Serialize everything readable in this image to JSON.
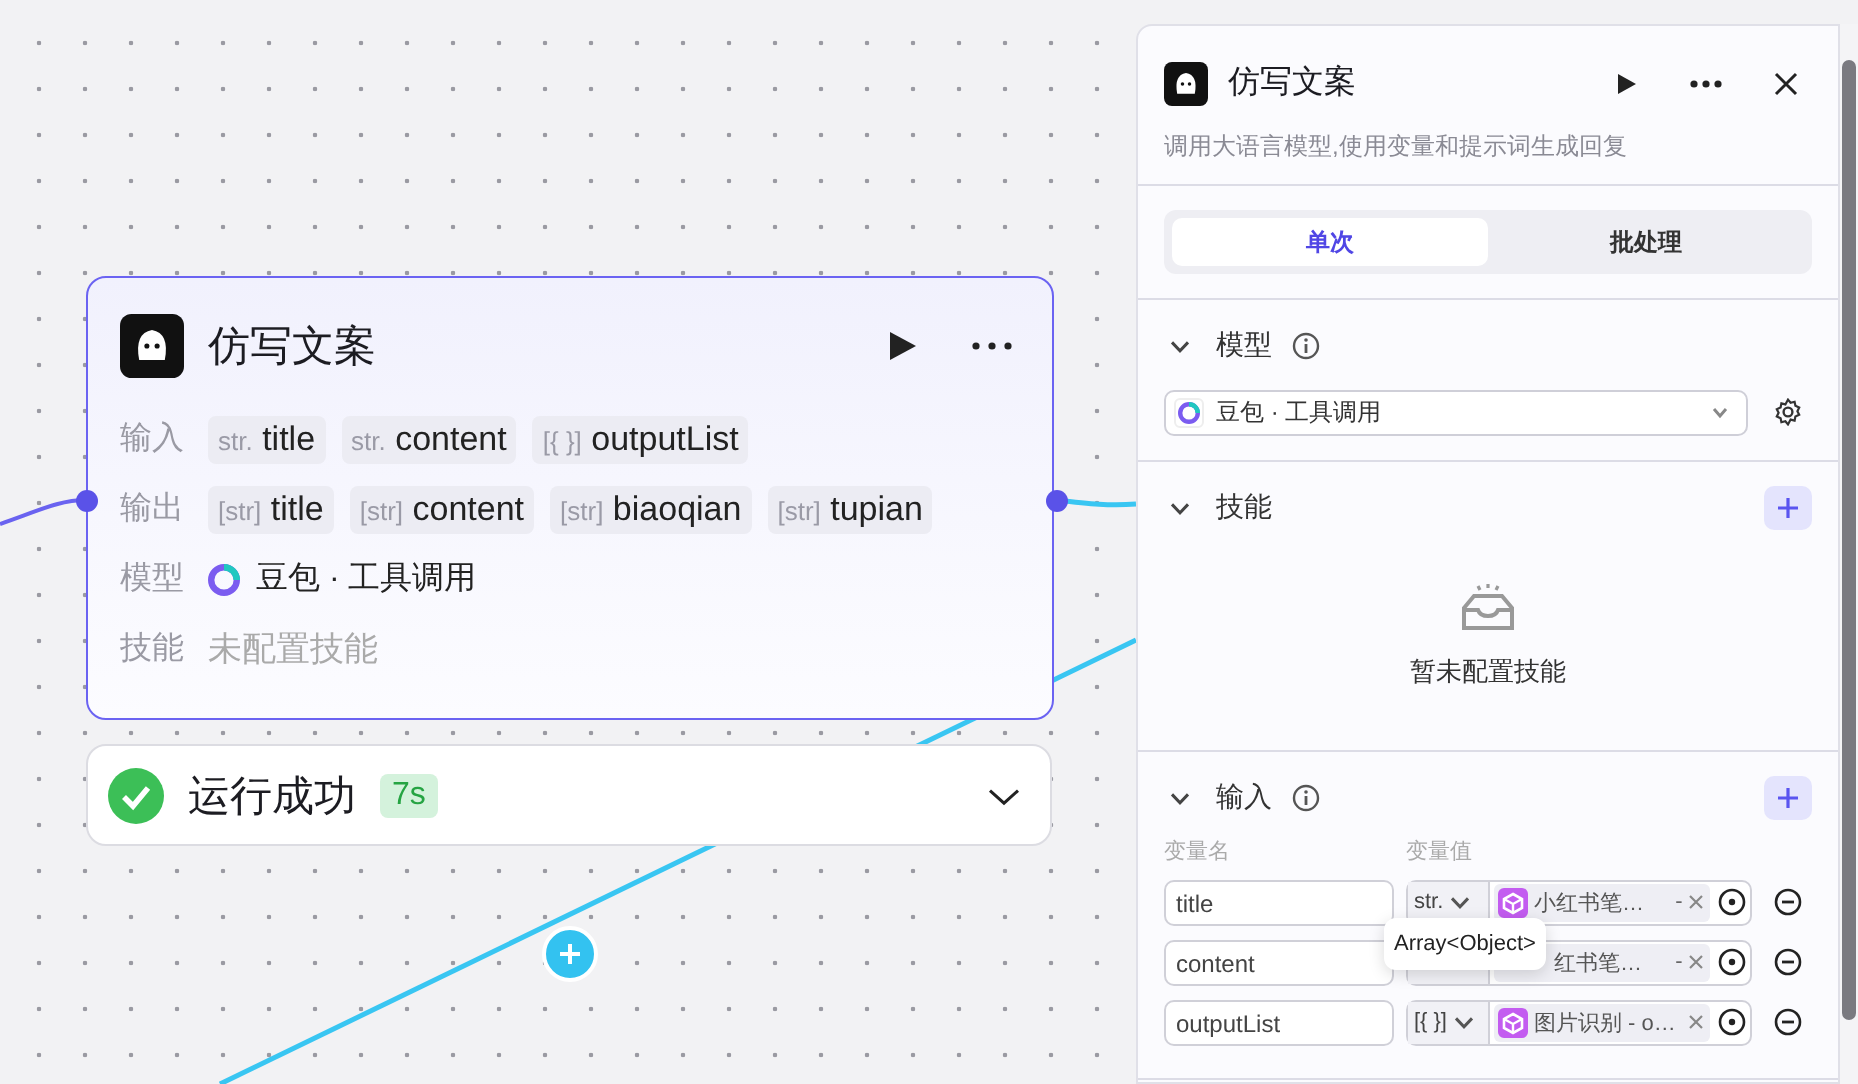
{
  "node": {
    "title": "仿写文案",
    "rows": [
      {
        "label": "输入",
        "kind": "ports",
        "ports": [
          {
            "type": "str.",
            "name": "title"
          },
          {
            "type": "str.",
            "name": "content"
          },
          {
            "type": "[{ }]",
            "name": "outputList"
          }
        ]
      },
      {
        "label": "输出",
        "kind": "ports",
        "ports": [
          {
            "type": "[str]",
            "name": "title"
          },
          {
            "type": "[str]",
            "name": "content"
          },
          {
            "type": "[str]",
            "name": "biaoqian"
          },
          {
            "type": "[str]",
            "name": "tupian"
          }
        ]
      },
      {
        "label": "模型",
        "kind": "model",
        "value": "豆包 · 工具调用"
      },
      {
        "label": "技能",
        "kind": "empty",
        "value": "未配置技能"
      }
    ]
  },
  "run_status": {
    "text": "运行成功",
    "duration": "7s"
  },
  "panel": {
    "title": "仿写文案",
    "description": "调用大语言模型,使用变量和提示词生成回复",
    "tabs": [
      {
        "label": "单次",
        "selected": true
      },
      {
        "label": "批处理",
        "selected": false
      }
    ],
    "model_section": {
      "title": "模型",
      "value": "豆包 · 工具调用"
    },
    "skills_section": {
      "title": "技能",
      "empty_text": "暂未配置技能"
    },
    "input_section": {
      "title": "输入",
      "column_1": "变量名",
      "column_2": "变量值",
      "rows": [
        {
          "name": "title",
          "type": "str.",
          "value": "小红书笔…",
          "suffix": "-"
        },
        {
          "name": "content",
          "value": "红书笔…",
          "suffix": "-"
        },
        {
          "name": "outputList",
          "type": "[{ }]",
          "value": "图片识别 - o…"
        }
      ]
    },
    "tooltip": "Array<Object>"
  }
}
